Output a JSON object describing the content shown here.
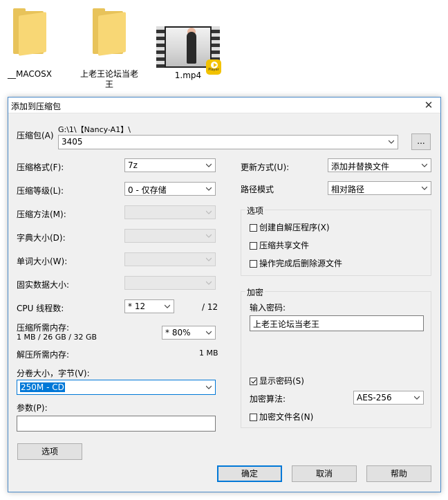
{
  "desktop": {
    "items": [
      {
        "label": "__MACOSX"
      },
      {
        "label": "上老王论坛当老王"
      },
      {
        "label": "1.mp4",
        "badge": "Player"
      }
    ]
  },
  "dialog": {
    "title": "添加到压缩包",
    "close_glyph": "✕",
    "archive": {
      "label": "压缩包(A)",
      "path": "G:\\1\\【Nancy-A1】\\",
      "value": "3405",
      "browse_label": "..."
    },
    "left": {
      "format_label": "压缩格式(F):",
      "format_value": "7z",
      "level_label": "压缩等级(L):",
      "level_value": "0 - 仅存储",
      "method_label": "压缩方法(M):",
      "method_value": "",
      "dict_label": "字典大小(D):",
      "dict_value": "",
      "word_label": "单词大小(W):",
      "word_value": "",
      "solid_label": "固实数据大小:",
      "solid_value": "",
      "cpu_label": "CPU 线程数:",
      "cpu_value": "* 12",
      "cpu_total": "/ 12",
      "mem_comp_label": "压缩所需内存:",
      "mem_comp_detail": "1 MB / 26 GB / 32 GB",
      "mem_percent": "* 80%",
      "mem_decomp_label": "解压所需内存:",
      "mem_decomp_value": "1 MB",
      "split_label": "分卷大小，字节(V):",
      "split_value": "250M - CD",
      "params_label": "参数(P):",
      "params_value": "",
      "options_button": "选项"
    },
    "right": {
      "update_label": "更新方式(U):",
      "update_value": "添加并替换文件",
      "path_label": "路径模式",
      "path_value": "相对路径",
      "options_group": {
        "title": "选项",
        "sfx": "创建自解压程序(X)",
        "shared": "压缩共享文件",
        "delete": "操作完成后删除源文件"
      },
      "encryption_group": {
        "title": "加密",
        "password_label": "输入密码:",
        "password_value": "上老王论坛当老王",
        "show_password": "显示密码(S)",
        "method_label": "加密算法:",
        "method_value": "AES-256",
        "encrypt_names": "加密文件名(N)"
      }
    },
    "buttons": {
      "ok": "确定",
      "cancel": "取消",
      "help": "帮助"
    }
  }
}
